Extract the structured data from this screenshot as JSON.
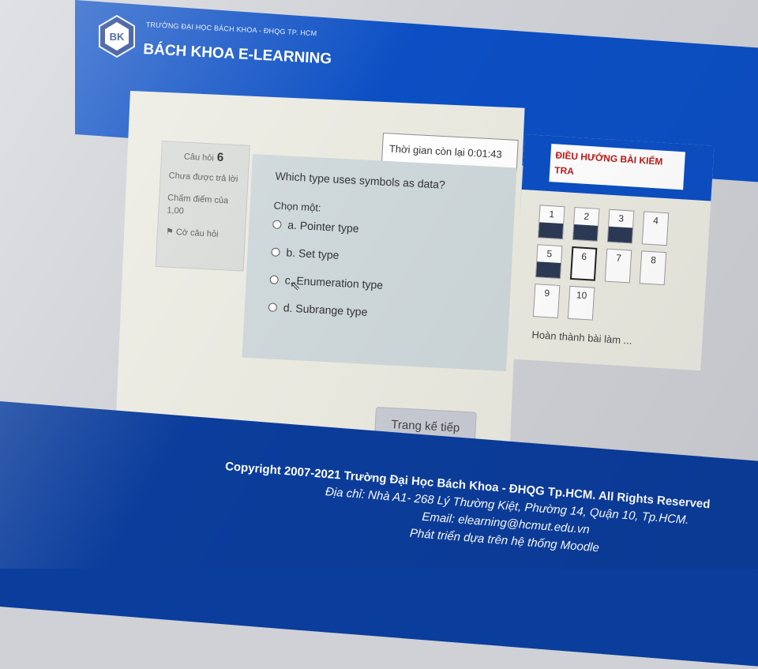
{
  "header": {
    "logo_text": "BK",
    "school_name": "TRƯỜNG ĐẠI HỌC BÁCH KHOA - ĐHQG TP. HCM",
    "site_name": "BÁCH KHOA E-LEARNING"
  },
  "question_info": {
    "label": "Câu hỏi",
    "number": "6",
    "status": "Chưa được trả lời",
    "mark": "Chấm điểm của 1,00",
    "flag": "Cờ câu hỏi"
  },
  "timer": {
    "text": "Thời gian còn lại 0:01:43"
  },
  "question": {
    "text": "Which type uses symbols as data?",
    "prompt": "Chọn một:",
    "answers": [
      "a. Pointer type",
      "b. Set type",
      "c. Enumeration type",
      "d. Subrange type"
    ]
  },
  "next_button": "Trang kế tiếp",
  "navigation": {
    "title": "ĐIỀU HƯỚNG BÀI KIỂM TRA",
    "cells": [
      {
        "label": "1",
        "answered": true
      },
      {
        "label": "2",
        "answered": true
      },
      {
        "label": "3",
        "answered": true
      },
      {
        "label": "4",
        "answered": false
      },
      {
        "label": "5",
        "answered": true
      },
      {
        "label": "6",
        "answered": false,
        "current": true
      },
      {
        "label": "7",
        "answered": false
      },
      {
        "label": "8",
        "answered": false
      },
      {
        "label": "9",
        "answered": false
      },
      {
        "label": "10",
        "answered": false
      }
    ],
    "finish": "Hoàn thành bài làm ..."
  },
  "footer": {
    "copyright": "Copyright 2007-2021 Trường Đại Học Bách Khoa - ĐHQG Tp.HCM. All Rights Reserved",
    "address": "Địa chỉ: Nhà A1- 268 Lý Thường Kiệt, Phường 14, Quận 10, Tp.HCM.",
    "email": "Email: elearning@hcmut.edu.vn",
    "powered": "Phát triển dựa trên hệ thống Moodle"
  },
  "colors": {
    "header_blue": "#0c4fc4",
    "footer_blue": "#0b3d9c",
    "nav_title_red": "#c01818",
    "answered_fill": "#2c3a56"
  }
}
